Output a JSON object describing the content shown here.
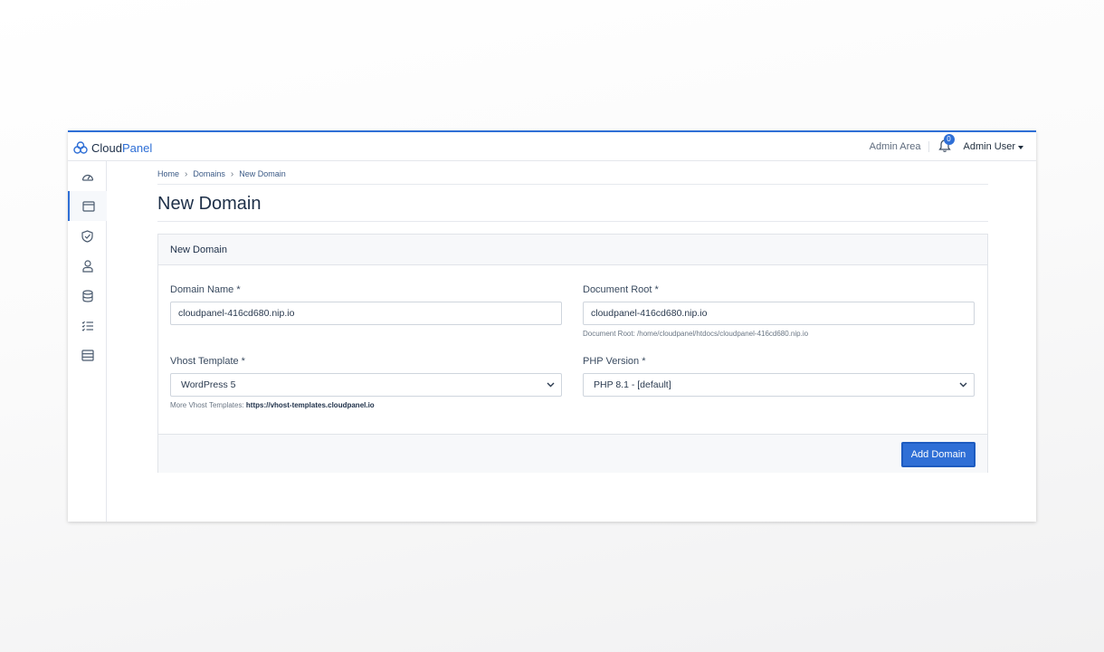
{
  "app": {
    "logo_cloud": "Cloud",
    "logo_panel": "Panel"
  },
  "topbar": {
    "admin_area": "Admin Area",
    "notification_count": "0",
    "user_menu": "Admin User"
  },
  "sidebar": {
    "items": [
      {
        "icon": "dashboard-gauge-icon"
      },
      {
        "icon": "sites-window-icon",
        "active": true
      },
      {
        "icon": "security-shield-icon"
      },
      {
        "icon": "users-person-icon"
      },
      {
        "icon": "databases-icon"
      },
      {
        "icon": "tasks-list-icon"
      },
      {
        "icon": "server-storage-icon"
      }
    ]
  },
  "breadcrumb": {
    "home": "Home",
    "domains": "Domains",
    "current": "New Domain"
  },
  "page": {
    "title": "New Domain"
  },
  "form": {
    "card_title": "New Domain",
    "domain_name_label": "Domain Name *",
    "domain_name_value": "cloudpanel-416cd680.nip.io",
    "document_root_label": "Document Root *",
    "document_root_value": "cloudpanel-416cd680.nip.io",
    "document_root_help": "Document Root: /home/cloudpanel/htdocs/cloudpanel-416cd680.nip.io",
    "vhost_label": "Vhost Template *",
    "vhost_value": "WordPress 5",
    "vhost_help_prefix": "More Vhost Templates:",
    "vhost_help_link": "https://vhost-templates.cloudpanel.io",
    "php_label": "PHP Version *",
    "php_value": "PHP 8.1 - [default]",
    "submit": "Add Domain"
  },
  "colors": {
    "accent": "#2f6fd6",
    "title": "#1d2f48"
  }
}
